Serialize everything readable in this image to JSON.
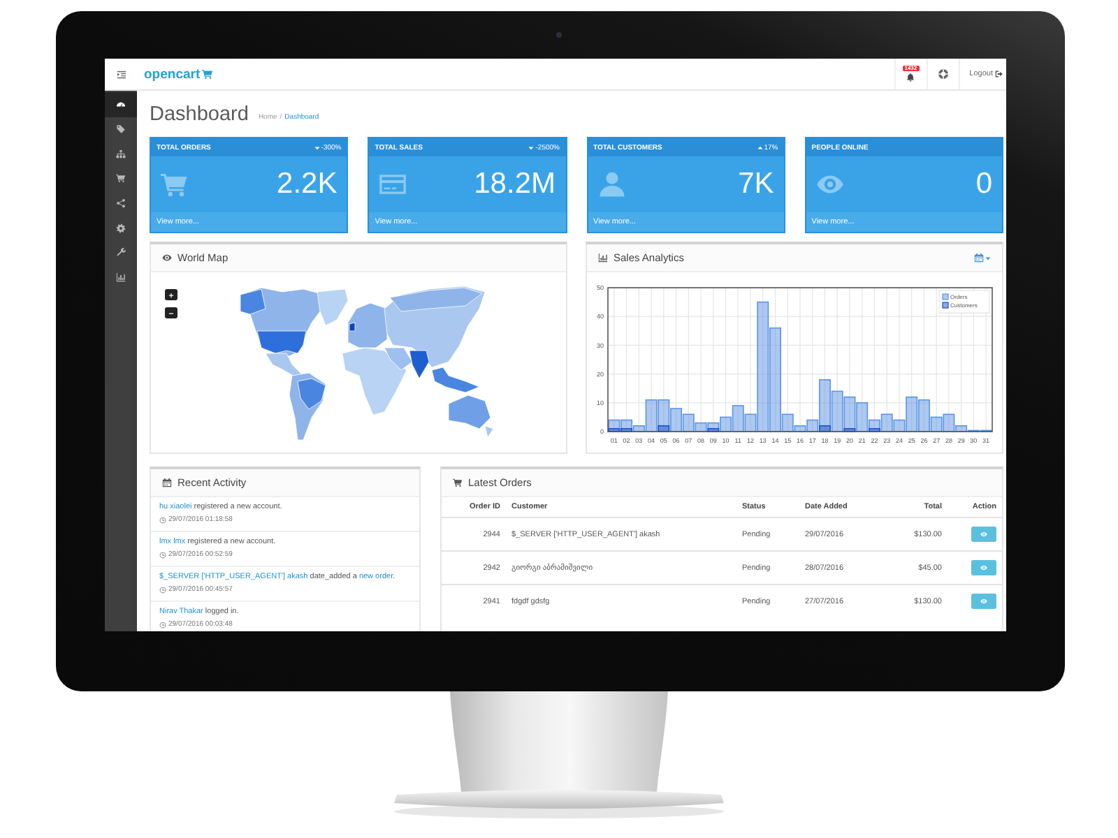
{
  "header": {
    "logo": "opencart",
    "notifications": "1432",
    "logout": "Logout"
  },
  "sidebar": {
    "items": [
      {
        "selected": true
      },
      {
        "selected": false
      },
      {
        "selected": false
      },
      {
        "selected": false
      },
      {
        "selected": false
      },
      {
        "selected": false
      },
      {
        "selected": false
      },
      {
        "selected": false
      }
    ]
  },
  "page": {
    "title": "Dashboard",
    "breadcrumb": [
      {
        "label": "Home",
        "selected": false
      },
      {
        "label": "Dashboard",
        "selected": true
      }
    ],
    "breadcrumb_separator": "/"
  },
  "tiles": [
    {
      "title": "TOTAL ORDERS",
      "rising": false,
      "change": "-300%",
      "value": "2.2K",
      "footer": "View more..."
    },
    {
      "title": "TOTAL SALES",
      "rising": false,
      "change": "-2500%",
      "value": "18.2M",
      "footer": "View more..."
    },
    {
      "title": "TOTAL CUSTOMERS",
      "rising": true,
      "change": "17%",
      "value": "7K",
      "footer": "View more..."
    },
    {
      "title": "PEOPLE ONLINE",
      "value": "0",
      "footer": "View more..."
    }
  ],
  "world_map": {
    "title": "World Map"
  },
  "sales_analytics": {
    "title": "Sales Analytics",
    "chart_data": {
      "type": "bar",
      "categories": [
        "01",
        "02",
        "03",
        "04",
        "05",
        "06",
        "07",
        "08",
        "09",
        "10",
        "11",
        "12",
        "13",
        "14",
        "15",
        "16",
        "17",
        "18",
        "19",
        "20",
        "21",
        "22",
        "23",
        "24",
        "25",
        "26",
        "27",
        "28",
        "29",
        "30",
        "31"
      ],
      "series": [
        {
          "name": "Orders",
          "color": "#5b94e4",
          "values": [
            4,
            4,
            2,
            11,
            11,
            8,
            6,
            3,
            3,
            5,
            9,
            6,
            45,
            36,
            6,
            2,
            4,
            18,
            14,
            12,
            10,
            4,
            6,
            4,
            12,
            11,
            5,
            6,
            2,
            0,
            0
          ]
        },
        {
          "name": "Customers",
          "color": "#1a54c7",
          "values": [
            1,
            1,
            0,
            0,
            2,
            0,
            0,
            0,
            1,
            0,
            0,
            0,
            0,
            0,
            0,
            0,
            0,
            2,
            0,
            1,
            0,
            1,
            0,
            0,
            0,
            0,
            0,
            0,
            0,
            0,
            0
          ]
        }
      ],
      "ylim": [
        0,
        50
      ],
      "yticks": [
        0,
        10,
        20,
        30,
        40,
        50
      ],
      "grid": true,
      "legend": true
    }
  },
  "recent_activity": {
    "title": "Recent Activity",
    "items": [
      {
        "parts": [
          {
            "kind": "link",
            "text": "hu xiaolei"
          },
          {
            "kind": "text",
            "text": " registered a new account."
          }
        ],
        "time": "29/07/2016 01:18:58"
      },
      {
        "parts": [
          {
            "kind": "link",
            "text": "lmx lmx"
          },
          {
            "kind": "text",
            "text": " registered a new account."
          }
        ],
        "time": "29/07/2016 00:52:59"
      },
      {
        "parts": [
          {
            "kind": "link",
            "text": "$_SERVER ['HTTP_USER_AGENT'] akash"
          },
          {
            "kind": "text",
            "text": " date_added a "
          },
          {
            "kind": "link",
            "text": "new order"
          },
          {
            "kind": "text",
            "text": "."
          }
        ],
        "time": "29/07/2016 00:45:57"
      },
      {
        "parts": [
          {
            "kind": "link",
            "text": "Nirav Thakar"
          },
          {
            "kind": "text",
            "text": " logged in."
          }
        ],
        "time": "29/07/2016 00:03:48"
      }
    ]
  },
  "latest_orders": {
    "title": "Latest Orders",
    "columns": [
      "Order ID",
      "Customer",
      "Status",
      "Date Added",
      "Total",
      "Action"
    ],
    "rows": [
      {
        "order_id": "2944",
        "customer": "$_SERVER ['HTTP_USER_AGENT'] akash",
        "status": "Pending",
        "date_added": "29/07/2016",
        "total": "$130.00"
      },
      {
        "order_id": "2942",
        "customer": "გიორგი აბრამიშვილი",
        "status": "Pending",
        "date_added": "28/07/2016",
        "total": "$45.00"
      },
      {
        "order_id": "2941",
        "customer": "fdgdf gdsfg",
        "status": "Pending",
        "date_added": "27/07/2016",
        "total": "$130.00"
      }
    ]
  }
}
